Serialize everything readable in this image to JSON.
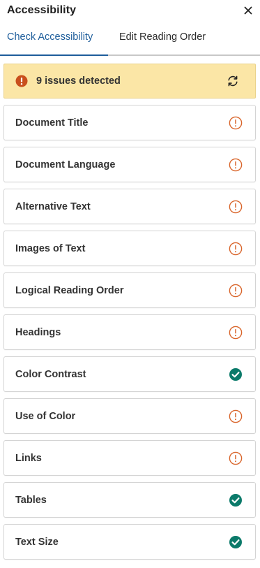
{
  "panel": {
    "title": "Accessibility",
    "close_icon": "close-icon"
  },
  "tabs": [
    {
      "label": "Check Accessibility",
      "active": true
    },
    {
      "label": "Edit Reading Order",
      "active": false
    }
  ],
  "banner": {
    "text": "9 issues detected",
    "status_icon": "error-filled-icon",
    "refresh_icon": "refresh-icon",
    "background": "#fbe6a6"
  },
  "colors": {
    "issue": "#d9652b",
    "pass": "#0b7a6a",
    "active_tab": "#1d5d9b",
    "error": "#c94f1c"
  },
  "checks": [
    {
      "label": "Document Title",
      "status": "issue"
    },
    {
      "label": "Document Language",
      "status": "issue"
    },
    {
      "label": "Alternative Text",
      "status": "issue"
    },
    {
      "label": "Images of Text",
      "status": "issue"
    },
    {
      "label": "Logical Reading Order",
      "status": "issue"
    },
    {
      "label": "Headings",
      "status": "issue"
    },
    {
      "label": "Color Contrast",
      "status": "pass"
    },
    {
      "label": "Use of Color",
      "status": "issue"
    },
    {
      "label": "Links",
      "status": "issue"
    },
    {
      "label": "Tables",
      "status": "pass"
    },
    {
      "label": "Text Size",
      "status": "pass"
    }
  ]
}
